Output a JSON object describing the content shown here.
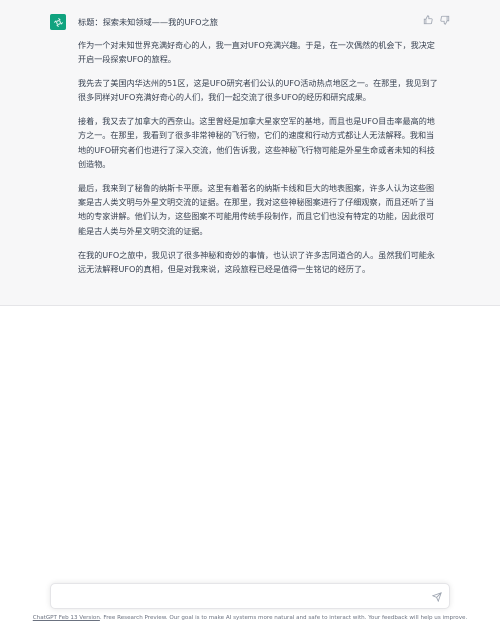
{
  "conversation": {
    "assistant_avatar_icon": "openai-logo-icon",
    "accent_color": "#10a37f",
    "title": "标题：探索未知领域——我的UFO之旅",
    "paragraphs": [
      "作为一个对未知世界充满好奇心的人，我一直对UFO充满兴趣。于是，在一次偶然的机会下，我决定开启一段探索UFO的旅程。",
      "我先去了美国内华达州的51区，这是UFO研究者们公认的UFO活动热点地区之一。在那里，我见到了很多同样对UFO充满好奇心的人们，我们一起交流了很多UFO的经历和研究成果。",
      "接着，我又去了加拿大的西奈山。这里曾经是加拿大星家空军的基地，而且也是UFO目击率最高的地方之一。在那里，我看到了很多非常神秘的飞行物，它们的速度和行动方式都让人无法解释。我和当地的UFO研究者们也进行了深入交流，他们告诉我，这些神秘飞行物可能是外星生命或者未知的科技创造物。",
      "最后，我来到了秘鲁的纳斯卡平原。这里有着著名的纳斯卡线和巨大的地表图案，许多人认为这些图案是古人类文明与外星文明交流的证据。在那里，我对这些神秘图案进行了仔细观察，而且还听了当地的专家讲解。他们认为，这些图案不可能用传统手段制作，而且它们也没有特定的功能，因此很可能是古人类与外星文明交流的证据。",
      "在我的UFO之旅中，我见识了很多神秘和奇妙的事情，也认识了许多志同道合的人。虽然我们可能永远无法解释UFO的真相，但是对我来说，这段旅程已经是值得一生铭记的经历了。"
    ],
    "thumbs_up_icon": "thumbs-up-icon",
    "thumbs_down_icon": "thumbs-down-icon"
  },
  "composer": {
    "placeholder": "",
    "send_icon": "paper-plane-icon"
  },
  "footer": {
    "version_link": "ChatGPT Feb 13 Version",
    "text": ". Free Research Preview. Our goal is to make AI systems more natural and safe to interact with. Your feedback will help us improve."
  }
}
